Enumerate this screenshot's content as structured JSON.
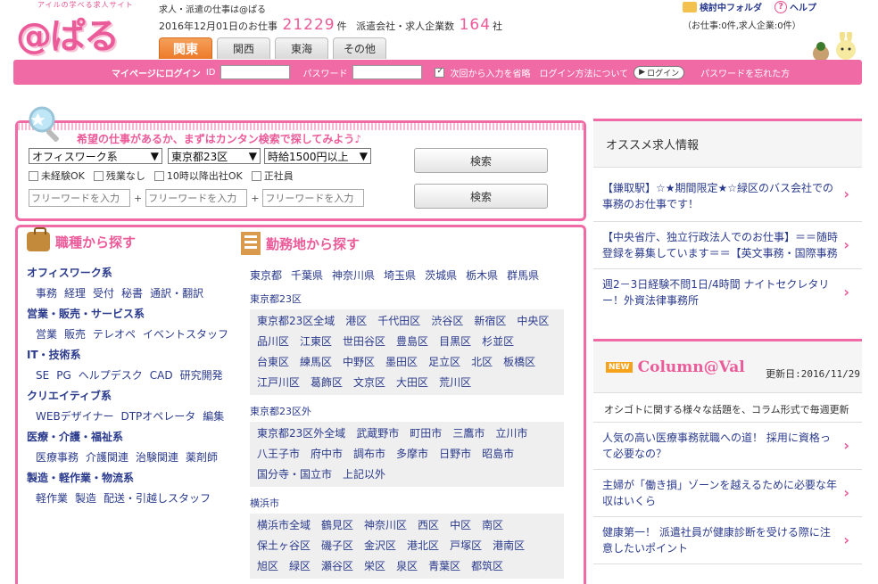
{
  "header": {
    "logo_tagline": "アイルの学べる求人サイト",
    "logo_text": "@ぱる",
    "tagline": "求人・派遣の仕事は@ぱる",
    "date_prefix": "2016年12月01日のお仕事",
    "job_count": "21229",
    "job_unit": "件",
    "company_label": "派遣会社・求人企業数",
    "company_count": "164",
    "company_unit": "社",
    "links": {
      "folder": "検討中フォルダ",
      "help": "ヘルプ"
    },
    "folder_count": "（お仕事:0件,求人企業:0件）",
    "tabs": [
      "関東",
      "関西",
      "東海",
      "その他"
    ],
    "active_tab": "関東"
  },
  "login": {
    "mypage_label": "マイページにログイン",
    "id_label": "ID",
    "password_label": "パスワード",
    "remember_label": "次回から入力を省略",
    "how_to_login": "ログイン方法について",
    "login_button": "ログイン",
    "forgot_password": "パスワードを忘れた方"
  },
  "search": {
    "lead": "希望の仕事があるか、まずはカンタン検索で探してみよう♪",
    "job_type_select": "オフィスワーク系",
    "area_select": "東京都23区",
    "wage_select": "時給1500円以上",
    "checkboxes": [
      "未経験OK",
      "残業なし",
      "10時以降出社OK",
      "正社員"
    ],
    "freeword_placeholder": "フリーワードを入力",
    "freeword_joiner": "+",
    "search_button_1": "検索",
    "search_button_2": "検索"
  },
  "jobs": {
    "heading": "職種から探す",
    "categories": [
      {
        "name": "オフィスワーク系",
        "items": [
          "事務",
          "経理",
          "受付",
          "秘書",
          "通訳・翻訳"
        ]
      },
      {
        "name": "営業・販売・サービス系",
        "items": [
          "営業",
          "販売",
          "テレオペ",
          "イベントスタッフ"
        ]
      },
      {
        "name": "IT・技術系",
        "items": [
          "SE",
          "PG",
          "ヘルプデスク",
          "CAD",
          "研究開発"
        ]
      },
      {
        "name": "クリエイティブ系",
        "items": [
          "WEBデザイナー",
          "DTPオペレータ",
          "編集"
        ]
      },
      {
        "name": "医療・介護・福祉系",
        "items": [
          "医療事務",
          "介護関連",
          "治験関連",
          "薬剤師"
        ]
      },
      {
        "name": "製造・軽作業・物流系",
        "items": [
          "軽作業",
          "製造",
          "配送・引越しスタッフ"
        ]
      }
    ]
  },
  "areas": {
    "heading": "勤務地から探す",
    "prefectures": [
      "東京都",
      "千葉県",
      "神奈川県",
      "埼玉県",
      "茨城県",
      "栃木県",
      "群馬県"
    ],
    "groups": [
      {
        "label": "東京都23区",
        "items": [
          "東京都23区全域",
          "港区",
          "千代田区",
          "渋谷区",
          "新宿区",
          "中央区",
          "品川区",
          "江東区",
          "世田谷区",
          "豊島区",
          "目黒区",
          "杉並区",
          "台東区",
          "練馬区",
          "中野区",
          "墨田区",
          "足立区",
          "北区",
          "板橋区",
          "江戸川区",
          "葛飾区",
          "文京区",
          "大田区",
          "荒川区"
        ]
      },
      {
        "label": "東京都23区外",
        "items": [
          "東京都23区外全域",
          "武蔵野市",
          "町田市",
          "三鷹市",
          "立川市",
          "八王子市",
          "府中市",
          "調布市",
          "多摩市",
          "日野市",
          "昭島市",
          "国分寺・国立市",
          "上記以外"
        ]
      },
      {
        "label": "横浜市",
        "items": [
          "横浜市全域",
          "鶴見区",
          "神奈川区",
          "西区",
          "中区",
          "南区",
          "保土ヶ谷区",
          "磯子区",
          "金沢区",
          "港北区",
          "戸塚区",
          "港南区",
          "旭区",
          "緑区",
          "瀬谷区",
          "栄区",
          "泉区",
          "青葉区",
          "都筑区"
        ]
      }
    ]
  },
  "recommend": {
    "title": "オススメ求人情報",
    "items": [
      "【鎌取駅】☆★期間限定★☆緑区のバス会社での事務のお仕事です！",
      "【中央省庁、独立行政法人でのお仕事】＝＝随時登録を募集しています＝＝【英文事務・国際事務",
      "週2－3日経験不問1日/4時間 ナイトセクレタリー！外資法律事務所"
    ]
  },
  "column": {
    "badge": "NEW",
    "logo": "Column@Val",
    "updated": "更新日:2016/11/29",
    "description": "オシゴトに関する様々な話題を、コラム形式で毎週更新",
    "items": [
      "人気の高い医療事務就職への道！ 採用に資格って必要なの？",
      "主婦が「働き損」ゾーンを越えるために必要な年収はいくら",
      "健康第一！ 派遣社員が健康診断を受ける際に注意したいポイント"
    ]
  },
  "colors": {
    "brand_pink": "#ec5b99",
    "bar_pink": "#f06aa5",
    "tab_orange": "#ec7a2a",
    "link_blue": "#2a3a8c"
  }
}
